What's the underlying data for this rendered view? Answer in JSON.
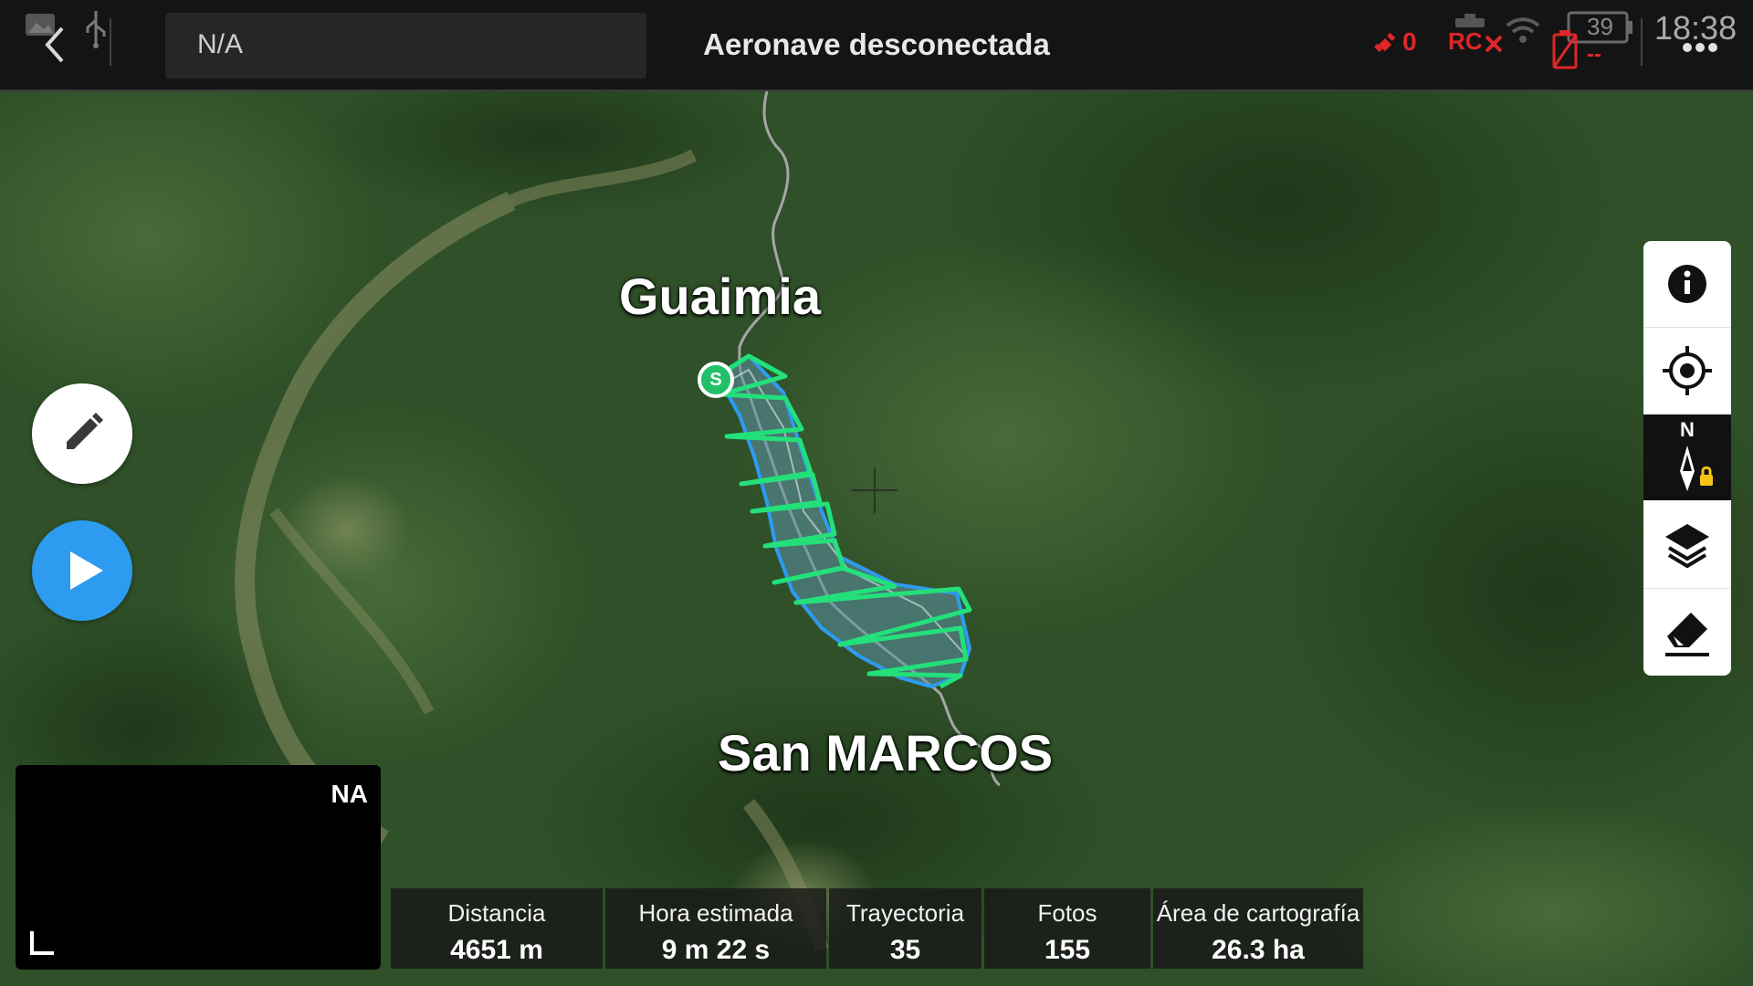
{
  "top_bar": {
    "search_value": "N/A",
    "title": "Aeronave desconectada",
    "satellite_count": "0",
    "rc_label": "RC",
    "battery_percent": "39",
    "aircraft_battery": "--",
    "time": "18:38"
  },
  "status_colors": {
    "warning": "#e02626",
    "accent": "#2d9bef",
    "waypoint": "#23e07a"
  },
  "map": {
    "labels": {
      "north_town": "Guaimia",
      "south_town": "San MARCOS"
    },
    "start_marker": "S",
    "compass_letter": "N",
    "icons": [
      "back-icon",
      "usb-icon",
      "gallery-icon",
      "satellite-icon",
      "rc-disconnected-icon",
      "wifi-icon",
      "battery-icon",
      "aircraft-battery-icon",
      "more-icon"
    ]
  },
  "left_actions": {
    "edit_icon": "pencil-icon",
    "play_icon": "play-icon"
  },
  "right_toolbar": [
    "info-icon",
    "locate-icon",
    "compass-lock-icon",
    "layers-icon",
    "eraser-icon"
  ],
  "mini_view": {
    "label": "NA"
  },
  "mission_info": [
    {
      "label": "Distancia",
      "value": "4651 m"
    },
    {
      "label": "Hora estimada",
      "value": "9 m 22 s"
    },
    {
      "label": "Trayectoria",
      "value": "35"
    },
    {
      "label": "Fotos",
      "value": "155"
    },
    {
      "label": "Área de cartografía",
      "value": "26.3 ha"
    }
  ]
}
